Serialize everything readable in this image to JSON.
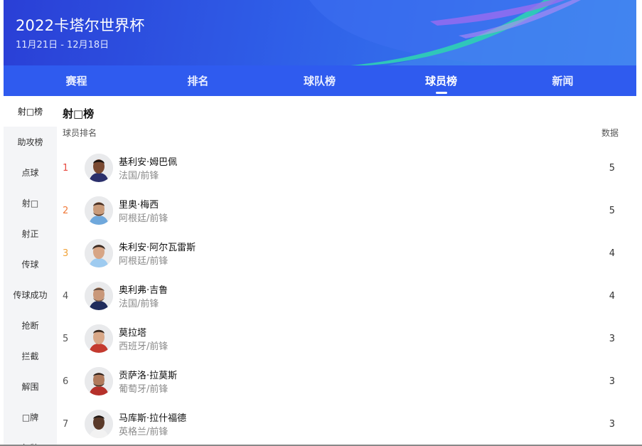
{
  "header": {
    "title": "2022卡塔尔世界杯",
    "dates": "11月21日 - 12月18日"
  },
  "nav": {
    "tabs": [
      "赛程",
      "排名",
      "球队榜",
      "球员榜",
      "新闻"
    ],
    "active": "球员榜"
  },
  "sidebar": {
    "items": [
      "射□榜",
      "助攻榜",
      "点球",
      "射□",
      "射正",
      "传球",
      "传球成功",
      "抢断",
      "拦截",
      "解围",
      "□牌",
      "红牌"
    ],
    "active": "射□榜"
  },
  "main": {
    "section_title": "射□榜",
    "col_left": "球员排名",
    "col_right": "数据",
    "rows": [
      {
        "rank": "1",
        "name": "基利安·姆巴佩",
        "info": "法国/前锋",
        "value": "5",
        "rank_color": "#e8493f"
      },
      {
        "rank": "2",
        "name": "里奥·梅西",
        "info": "阿根廷/前锋",
        "value": "5",
        "rank_color": "#f07a3a"
      },
      {
        "rank": "3",
        "name": "朱利安·阿尔瓦雷斯",
        "info": "阿根廷/前锋",
        "value": "4",
        "rank_color": "#f0a33a"
      },
      {
        "rank": "4",
        "name": "奥利弗·吉鲁",
        "info": "法国/前锋",
        "value": "4",
        "rank_color": "#555555"
      },
      {
        "rank": "5",
        "name": "莫拉塔",
        "info": "西班牙/前锋",
        "value": "3",
        "rank_color": "#555555"
      },
      {
        "rank": "6",
        "name": "贡萨洛·拉莫斯",
        "info": "葡萄牙/前锋",
        "value": "3",
        "rank_color": "#555555"
      },
      {
        "rank": "7",
        "name": "马库斯·拉什福德",
        "info": "英格兰/前锋",
        "value": "3",
        "rank_color": "#555555"
      }
    ]
  },
  "colors": {
    "header_blue": "#2f5bef",
    "accent_teal": "#2fd0b4",
    "accent_purple": "#9b6cf0"
  }
}
